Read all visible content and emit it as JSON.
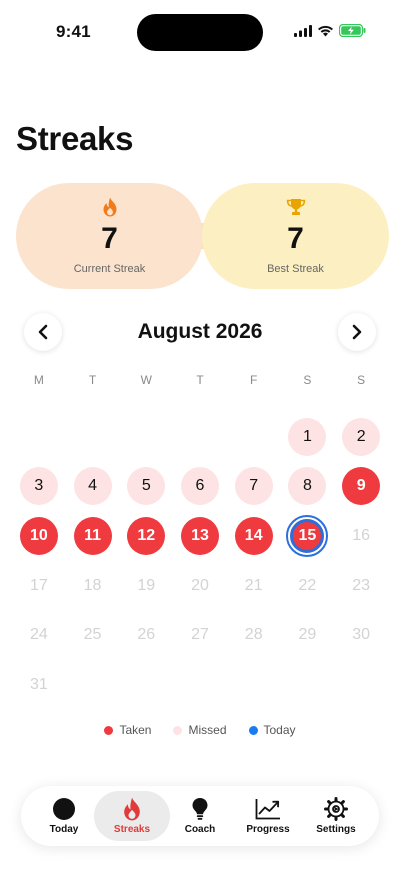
{
  "status": {
    "time": "9:41"
  },
  "title": "Streaks",
  "cards": {
    "current": {
      "value": "7",
      "label": "Current Streak",
      "icon": "flame-icon"
    },
    "best": {
      "value": "7",
      "label": "Best Streak",
      "icon": "trophy-icon"
    }
  },
  "month": {
    "label": "August 2026"
  },
  "weekdays": [
    "M",
    "T",
    "W",
    "T",
    "F",
    "S",
    "S"
  ],
  "calendar": {
    "leading_blanks": 5,
    "days": [
      {
        "d": "1",
        "s": "missed"
      },
      {
        "d": "2",
        "s": "missed"
      },
      {
        "d": "3",
        "s": "missed"
      },
      {
        "d": "4",
        "s": "missed"
      },
      {
        "d": "5",
        "s": "missed"
      },
      {
        "d": "6",
        "s": "missed"
      },
      {
        "d": "7",
        "s": "missed"
      },
      {
        "d": "8",
        "s": "missed"
      },
      {
        "d": "9",
        "s": "taken"
      },
      {
        "d": "10",
        "s": "taken"
      },
      {
        "d": "11",
        "s": "taken"
      },
      {
        "d": "12",
        "s": "taken"
      },
      {
        "d": "13",
        "s": "taken"
      },
      {
        "d": "14",
        "s": "taken"
      },
      {
        "d": "15",
        "s": "today"
      },
      {
        "d": "16",
        "s": "future"
      },
      {
        "d": "17",
        "s": "future"
      },
      {
        "d": "18",
        "s": "future"
      },
      {
        "d": "19",
        "s": "future"
      },
      {
        "d": "20",
        "s": "future"
      },
      {
        "d": "21",
        "s": "future"
      },
      {
        "d": "22",
        "s": "future"
      },
      {
        "d": "23",
        "s": "future"
      },
      {
        "d": "24",
        "s": "future"
      },
      {
        "d": "25",
        "s": "future"
      },
      {
        "d": "26",
        "s": "future"
      },
      {
        "d": "27",
        "s": "future"
      },
      {
        "d": "28",
        "s": "future"
      },
      {
        "d": "29",
        "s": "future"
      },
      {
        "d": "30",
        "s": "future"
      },
      {
        "d": "31",
        "s": "future"
      }
    ]
  },
  "legend": [
    {
      "label": "Taken",
      "color": "#ef3a3f"
    },
    {
      "label": "Missed",
      "color": "#fde3e3"
    },
    {
      "label": "Today",
      "color": "#1a7cf0"
    }
  ],
  "tabs": [
    {
      "label": "Today",
      "icon": "circle-icon",
      "active": false
    },
    {
      "label": "Streaks",
      "icon": "flame-icon",
      "active": true
    },
    {
      "label": "Coach",
      "icon": "lightbulb-icon",
      "active": false
    },
    {
      "label": "Progress",
      "icon": "chart-icon",
      "active": false
    },
    {
      "label": "Settings",
      "icon": "gear-icon",
      "active": false
    }
  ],
  "colors": {
    "accent": "#ef3a3f",
    "today_ring": "#2a6fdc",
    "current_card": "#fce3cd",
    "best_card": "#fcf0c2"
  }
}
